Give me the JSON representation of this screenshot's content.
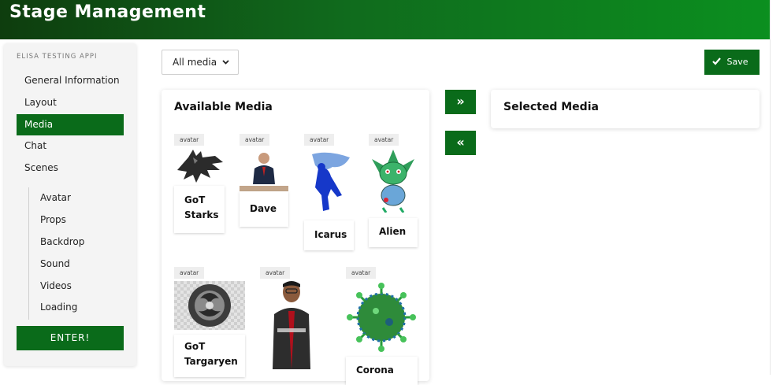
{
  "header": {
    "title": "Stage Management"
  },
  "sidebar": {
    "app_title": "ELISA TESTING APPI",
    "items": [
      {
        "label": "General Information"
      },
      {
        "label": "Layout"
      },
      {
        "label": "Media",
        "active": true
      },
      {
        "label": "Chat"
      },
      {
        "label": "Scenes"
      }
    ],
    "subitems": [
      {
        "label": "Avatar"
      },
      {
        "label": "Props"
      },
      {
        "label": "Backdrop"
      },
      {
        "label": "Sound"
      },
      {
        "label": "Videos"
      },
      {
        "label": "Loading"
      }
    ],
    "enter_label": "ENTER!"
  },
  "toolbar": {
    "filter_value": "All media",
    "caret_icon": "chevron-down-icon",
    "save_label": "Save",
    "save_icon": "check-icon"
  },
  "available": {
    "title": "Available Media",
    "items": [
      {
        "tag": "avatar",
        "name_line1": "GoT",
        "name_line2": "Starks",
        "image": "direwolf-sigil"
      },
      {
        "tag": "avatar",
        "name_line1": "Dave",
        "name_line2": "",
        "image": "man-at-podium"
      },
      {
        "tag": "avatar",
        "name_line1": "Icarus",
        "name_line2": "",
        "image": "blue-winged-figure"
      },
      {
        "tag": "avatar",
        "name_line1": "Alien",
        "name_line2": "",
        "image": "green-alien-drawing"
      },
      {
        "tag": "avatar",
        "name_line1": "GoT",
        "name_line2": "Targaryen",
        "image": "dragon-sigil"
      },
      {
        "tag": "avatar",
        "name_line1": "",
        "name_line2": "",
        "image": "man-in-jacket"
      },
      {
        "tag": "avatar",
        "name_line1": "Corona",
        "name_line2": "",
        "image": "green-virus"
      }
    ]
  },
  "selected": {
    "title": "Selected Media"
  },
  "transfer": {
    "add_icon": "double-chevron-right-icon",
    "remove_icon": "double-chevron-left-icon",
    "add_glyph": "»",
    "remove_glyph": "«"
  },
  "colors": {
    "brand_green": "#0a6b1a",
    "header_start": "#0e3d0e",
    "header_end": "#0b8f1f"
  }
}
